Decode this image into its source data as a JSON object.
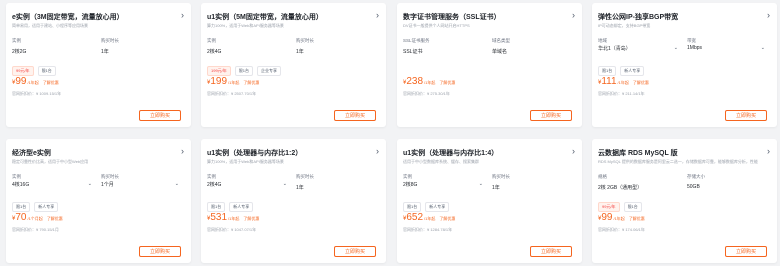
{
  "cards": [
    {
      "title": "e实例（3M固定带宽，流量放心用）",
      "desc": "简单易用，适用于建站、小程序等应用场景",
      "f1_label": "实例",
      "f1_value": "2核2G",
      "f2_label": "购买时长",
      "f2_value": "1年",
      "tags": [
        "99元/年",
        "限1台"
      ],
      "currency": "¥",
      "price": "99",
      "unit": "/1年起",
      "more": "了解优惠",
      "orig": "官网折扣价：¥ 1009.15/1年",
      "buy": "立即购买"
    },
    {
      "title": "u1实例（5M固定带宽，流量放心用）",
      "desc": "算力100%，适用于Web和API服务器等场景",
      "f1_label": "实例",
      "f1_value": "2核4G",
      "f2_label": "购买时长",
      "f2_value": "1年",
      "tags": [
        "199元/年",
        "限1台",
        "企业专享"
      ],
      "currency": "¥",
      "price": "199",
      "unit": "/1年起",
      "more": "了解优惠",
      "orig": "官网折扣价：¥ 2507.70/1年",
      "buy": "立即购买"
    },
    {
      "title": "数字证书管理服务（SSL证书）",
      "desc": "DV证书一般提供个人网站开启HTTPS",
      "f1_label": "SSL证书服务",
      "f1_value": "SSL证书",
      "f2_label": "域名类型",
      "f2_value": "单域名",
      "tags": [],
      "currency": "¥",
      "price": "238",
      "unit": "/1年起",
      "more": "了解优惠",
      "orig": "官网折扣价：¥ 275.30/1年",
      "buy": "立即购买"
    },
    {
      "title": "弹性公网IP-独享BGP带宽",
      "desc": "IP可动态绑定，支持BGP带宽",
      "f1_label": "地域",
      "f1_value": "华北1（青岛）",
      "f2_label": "带宽",
      "f2_value": "1Mbps",
      "tags": [
        "限1台",
        "新人专享"
      ],
      "currency": "¥",
      "price": "111",
      "unit": "/1年起",
      "more": "了解优惠",
      "orig": "官网折扣价：¥ 211.14/1年",
      "buy": "立即购买"
    },
    {
      "title": "经济型e实例",
      "desc": "稳定可靠性价比高，适用于中小型Web应用",
      "f1_label": "实例",
      "f1_value": "4核16G",
      "f2_label": "购买时长",
      "f2_value": "1个月",
      "tags": [
        "限1台",
        "新人专享"
      ],
      "currency": "¥",
      "price": "70",
      "unit": "/1个月起",
      "more": "了解优惠",
      "orig": "官网折扣价：¥ 790.15/1月",
      "buy": "立即购买"
    },
    {
      "title": "u1实例（处理器与内存比1:2）",
      "desc": "算力100%，适用于Web和API服务器等场景",
      "f1_label": "实例",
      "f1_value": "2核4G",
      "f2_label": "购买时长",
      "f2_value": "1年",
      "tags": [
        "限1台",
        "新人专享"
      ],
      "currency": "¥",
      "price": "531",
      "unit": "/1年起",
      "more": "了解优惠",
      "orig": "官网折扣价：¥ 1047.07/1年",
      "buy": "立即购买"
    },
    {
      "title": "u1实例（处理器与内存比1:4）",
      "desc": "适用于中小型数据库系统、缓存、搜索集群",
      "f1_label": "实例",
      "f1_value": "2核8G",
      "f2_label": "购买时长",
      "f2_value": "1年",
      "tags": [
        "限1台",
        "新人专享"
      ],
      "currency": "¥",
      "price": "652",
      "unit": "/1年起",
      "more": "了解优惠",
      "orig": "官网折扣价：¥ 1284.78/1年",
      "buy": "立即购买"
    },
    {
      "title": "云数据库 RDS MySQL 版",
      "desc": "RDS MySQL 提供的数据库服务是阿里云二选一，存储数据库可靠，能够数据库分析，性能",
      "f1_label": "规格",
      "f1_value": "2核 2GB（通用型）",
      "f2_label": "存储大小",
      "f2_value": "50GB",
      "tags": [
        "99元/年",
        "限1台"
      ],
      "currency": "¥",
      "price": "99",
      "unit": "/1年起",
      "more": "了解优惠",
      "orig": "官网折扣价：¥ 174.06/1年",
      "buy": "立即购买"
    }
  ],
  "icons": {
    "chevron_right": "chevron-right-icon",
    "chevron_down": "chevron-down-icon"
  },
  "colors": {
    "accent": "#f5651f",
    "hot_tag": "#f53f3f",
    "background": "#f2f3f5"
  }
}
